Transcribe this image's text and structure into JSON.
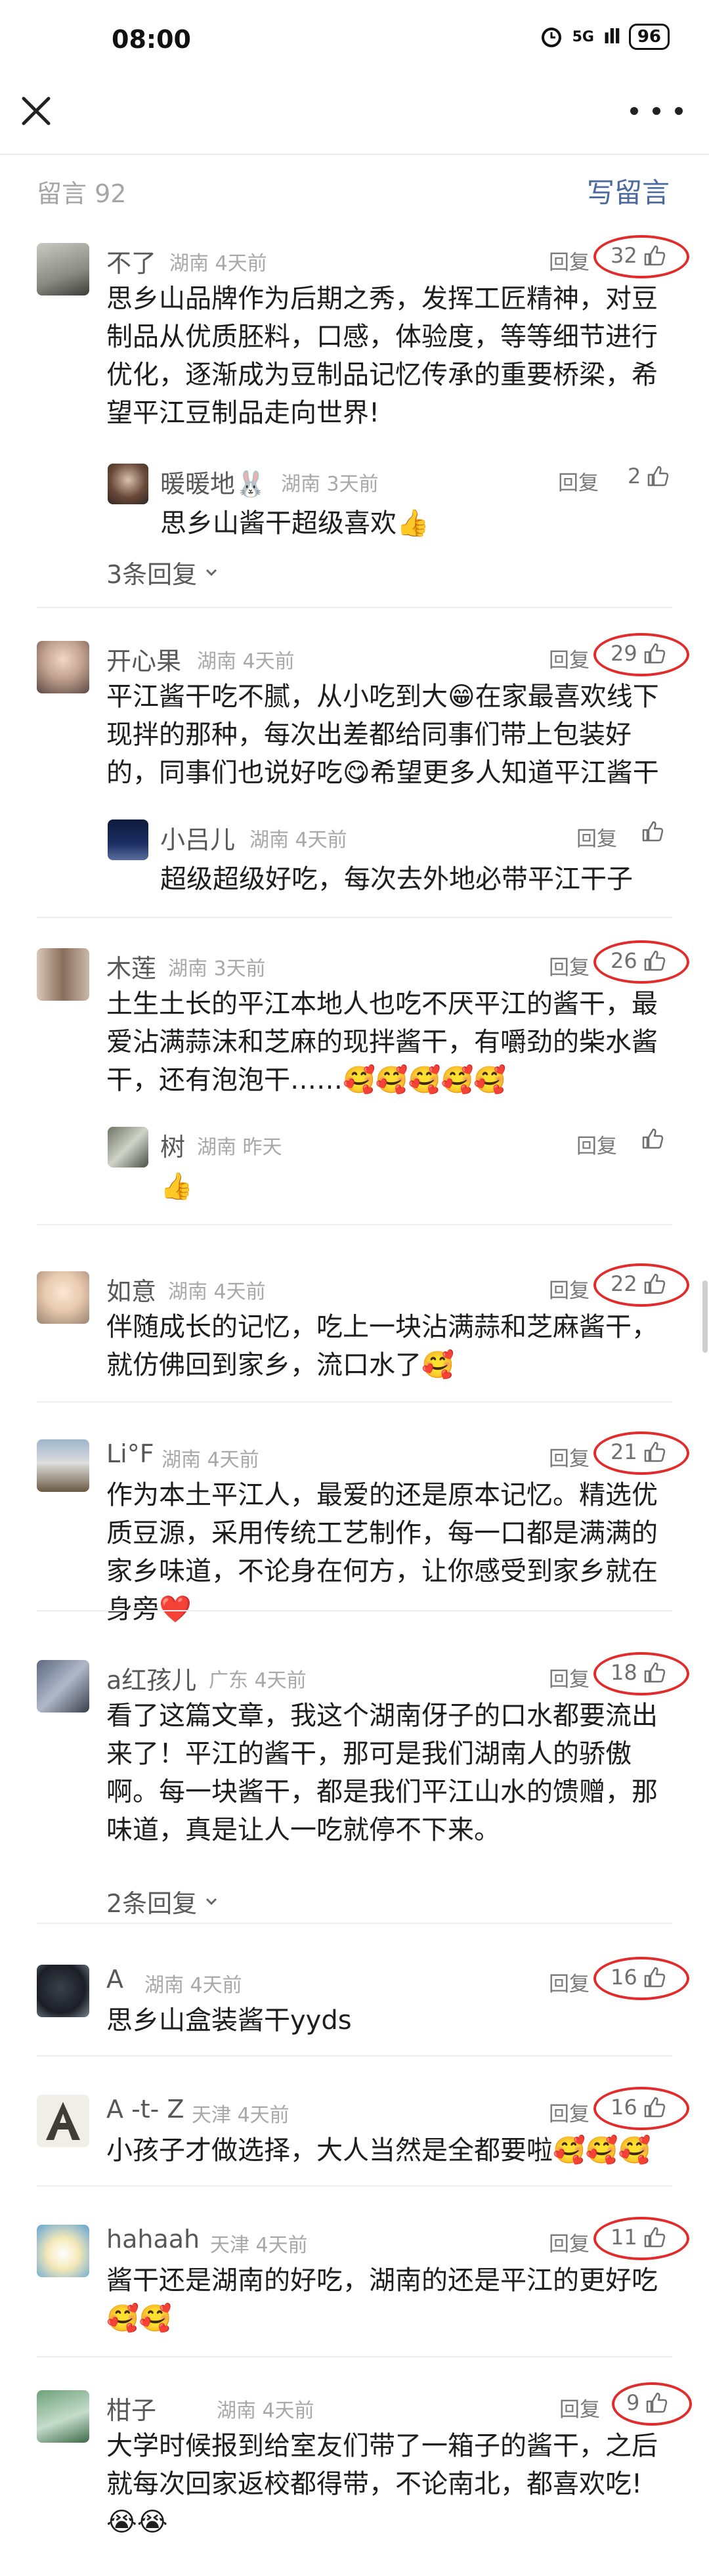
{
  "status_bar": {
    "time": "08:00",
    "network": "5G",
    "signal": "ıll",
    "battery": "96"
  },
  "header": {
    "count_label": "留言 92",
    "write_label": "写留言"
  },
  "reply_label": "回复",
  "emoji": {
    "grin": "😁",
    "yum": "😋",
    "thumbs_up": "👍",
    "rabbit": "🐰",
    "love": "🥰",
    "heart": "❤️",
    "cry": "😭"
  },
  "comments": [
    {
      "name": "不了",
      "region": "湖南 4天前",
      "likes": "32",
      "text": "思乡山品牌作为后期之秀，发挥工匠精神，对豆制品从优质胚料，口感，体验度，等等细节进行优化，逐渐成为豆制品记忆传承的重要桥梁，希望平江豆制品走向世界!",
      "reply": {
        "name": "暖暖地",
        "region": "湖南 3天前",
        "likes": "2",
        "text": "思乡山酱干超级喜欢"
      },
      "expand": "3条回复"
    },
    {
      "name": "开心果",
      "region": "湖南 4天前",
      "likes": "29",
      "text_a": "平江酱干吃不腻，从小吃到大",
      "text_b": "在家最喜欢线下现拌的那种，每次出差都给同事们带上包装好的，同事们也说好吃",
      "text_c": "希望更多人知道平江酱干",
      "reply": {
        "name": "小吕儿",
        "region": "湖南 4天前",
        "likes": "",
        "text": "超级超级好吃，每次去外地必带平江干子"
      }
    },
    {
      "name": "木莲",
      "region": "湖南 3天前",
      "likes": "26",
      "text": "土生土长的平江本地人也吃不厌平江的酱干，最爱沾满蒜沫和芝麻的现拌酱干，有嚼劲的柴水酱干，还有泡泡干……",
      "reply": {
        "name": "树",
        "region": "湖南 昨天",
        "likes": ""
      }
    },
    {
      "name": "如意",
      "region": "湖南 4天前",
      "likes": "22",
      "text": "伴随成长的记忆，吃上一块沾满蒜和芝麻酱干，就仿佛回到家乡，流口水了"
    },
    {
      "name": "Li°F",
      "region": "湖南 4天前",
      "likes": "21",
      "text": "作为本土平江人，最爱的还是原本记忆。精选优质豆源，采用传统工艺制作，每一口都是满满的家乡味道，不论身在何方，让你感受到家乡就在身旁"
    },
    {
      "name": "a红孩儿",
      "region": "广东 4天前",
      "likes": "18",
      "text": "看了这篇文章，我这个湖南伢子的口水都要流出来了！平江的酱干，那可是我们湖南人的骄傲啊。每一块酱干，都是我们平江山水的馈赠，那味道，真是让人一吃就停不下来。",
      "expand": "2条回复"
    },
    {
      "name": "A",
      "region": "湖南 4天前",
      "likes": "16",
      "text": "思乡山盒装酱干yyds"
    },
    {
      "name": "A -t- Z",
      "region": "天津 4天前",
      "likes": "16",
      "text": "小孩子才做选择，大人当然是全都要啦"
    },
    {
      "name": "hahaah",
      "region": "天津 4天前",
      "likes": "11",
      "text": "酱干还是湖南的好吃，湖南的还是平江的更好吃"
    },
    {
      "name": "柑子",
      "region": "湖南 4天前",
      "likes": "9",
      "text": "大学时候报到给室友们带了一箱子的酱干，之后就每次回家返校都得带，不论南北，都喜欢吃!"
    }
  ]
}
